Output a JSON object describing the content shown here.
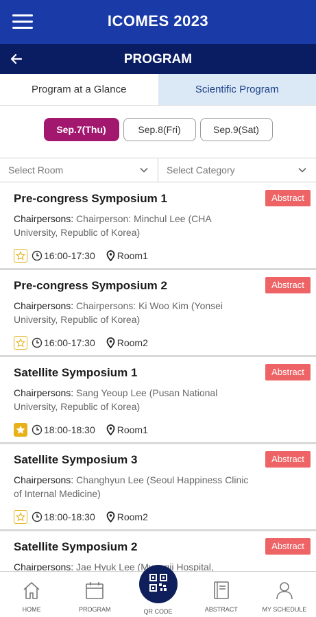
{
  "header": {
    "app_title": "ICOMES 2023"
  },
  "subheader": {
    "title": "PROGRAM"
  },
  "tabs": [
    {
      "label": "Program at a Glance",
      "active": false
    },
    {
      "label": "Scientific Program",
      "active": true
    }
  ],
  "days": [
    {
      "label": "Sep.7(Thu)",
      "active": true
    },
    {
      "label": "Sep.8(Fri)",
      "active": false
    },
    {
      "label": "Sep.9(Sat)",
      "active": false
    }
  ],
  "filters": {
    "room": "Select Room",
    "category": "Select Category"
  },
  "sessions": [
    {
      "title": "Pre-congress Symposium 1",
      "chair_label": "Chairpersons:",
      "chair_text": " Chairperson: Minchul Lee (CHA University, Republic of Korea)",
      "abstract_label": "Abstract",
      "favorite": false,
      "time": "16:00-17:30",
      "room": "Room1"
    },
    {
      "title": "Pre-congress Symposium 2",
      "chair_label": "Chairpersons:",
      "chair_text": " Chairpersons: Ki Woo Kim (Yonsei University, Republic of Korea)",
      "abstract_label": "Abstract",
      "favorite": false,
      "time": "16:00-17:30",
      "room": "Room2"
    },
    {
      "title": "Satellite Symposium 1",
      "chair_label": "Chairpersons:",
      "chair_text": " Sang Yeoup Lee (Pusan National University, Republic of Korea)",
      "abstract_label": "Abstract",
      "favorite": true,
      "time": "18:00-18:30",
      "room": "Room1"
    },
    {
      "title": "Satellite Symposium 3",
      "chair_label": "Chairpersons:",
      "chair_text": " Changhyun Lee (Seoul Happiness Clinic of Internal Medicine)",
      "abstract_label": "Abstract",
      "favorite": false,
      "time": "18:00-18:30",
      "room": "Room2"
    },
    {
      "title": "Satellite Symposium 2",
      "chair_label": "Chairpersons:",
      "chair_text": " Jae Hyuk Lee (Myongji Hospital,",
      "abstract_label": "Abstract",
      "favorite": false,
      "time": "",
      "room": ""
    }
  ],
  "bottom_nav": [
    {
      "label": "HOME",
      "icon": "home-icon"
    },
    {
      "label": "PROGRAM",
      "icon": "calendar-icon"
    },
    {
      "label": "QR CODE",
      "icon": "qr-code-icon"
    },
    {
      "label": "ABSTRACT",
      "icon": "book-icon"
    },
    {
      "label": "MY SCHEDULE",
      "icon": "person-icon"
    }
  ],
  "colors": {
    "header": "#1a3aa8",
    "subheader": "#0a1d63",
    "active_day": "#a3186f",
    "abstract": "#ee6466",
    "star": "#e9b118",
    "active_tab_bg": "#dbe8f6"
  }
}
